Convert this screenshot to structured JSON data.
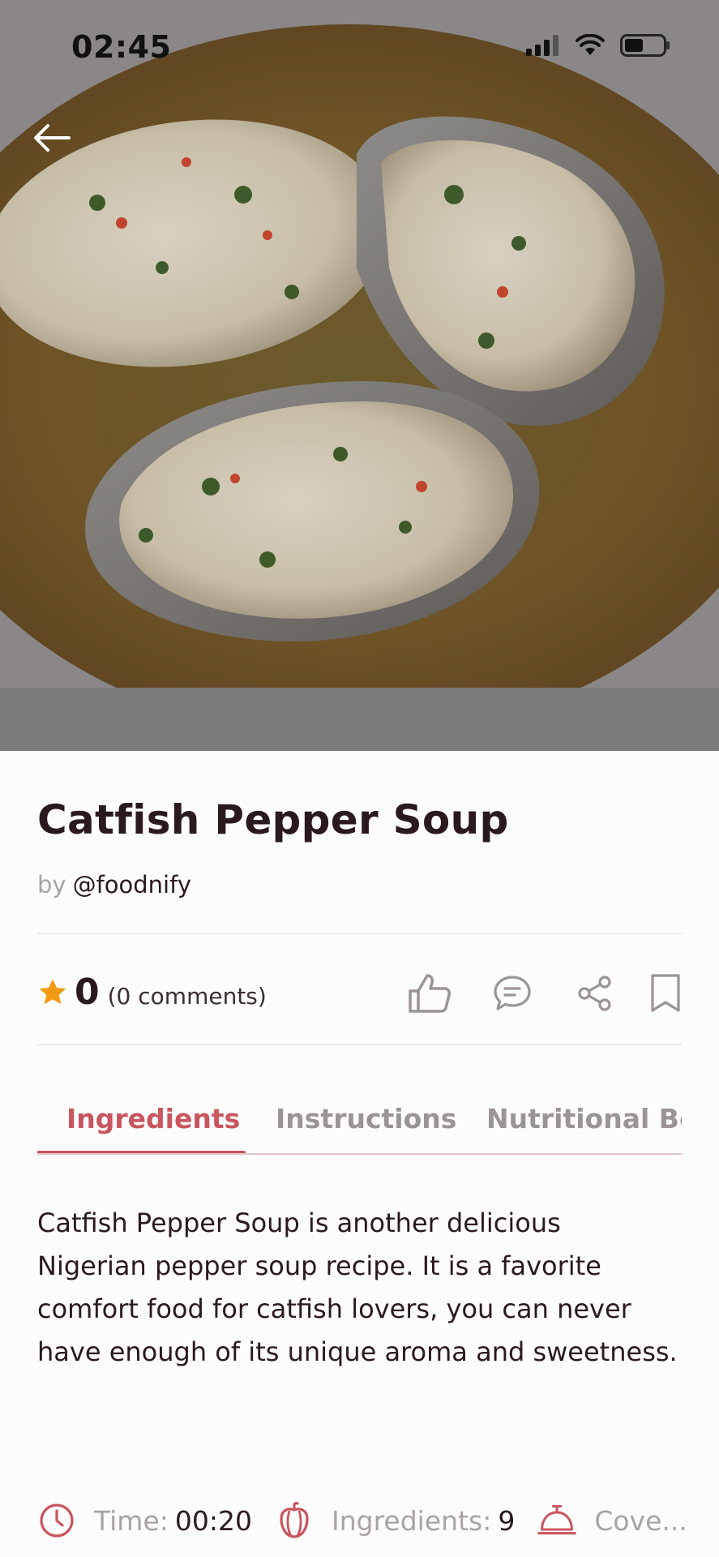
{
  "status_bar": {
    "time": "02:45"
  },
  "recipe": {
    "title": "Catfish Pepper Soup",
    "by_prefix": "by",
    "author": "@foodnify",
    "rating": "0",
    "comments": "(0 comments)",
    "description": "Catfish Pepper Soup is another delicious Nigerian pepper soup recipe. It is a favorite comfort food for catfish lovers, you can never have enough of its unique aroma and sweetness."
  },
  "tabs": [
    {
      "label": "Ingredients",
      "active": true
    },
    {
      "label": "Instructions",
      "active": false
    },
    {
      "label": "Nutritional Ben",
      "active": false
    }
  ],
  "meta": {
    "time_label": "Time:",
    "time_value": "00:20",
    "ingredients_label": "Ingredients:",
    "ingredients_value": "9",
    "covers_label": "Cove..."
  },
  "icons": {
    "back": "arrow-left-icon",
    "like": "thumbs-up-icon",
    "comment": "comment-icon",
    "share": "share-icon",
    "bookmark": "bookmark-icon",
    "time": "clock-icon",
    "ingredients": "pepper-icon",
    "covers": "serving-bell-icon"
  },
  "colors": {
    "accent": "#c9555e",
    "star": "#f29a12",
    "text": "#2a1a1d",
    "muted": "#a9a3a4"
  }
}
